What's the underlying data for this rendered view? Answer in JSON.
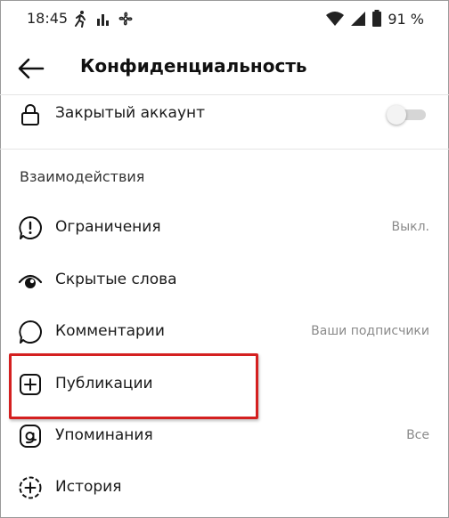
{
  "statusbar": {
    "time": "18:45",
    "battery": "91 %"
  },
  "header": {
    "title": "Конфиденциальность"
  },
  "private_account": {
    "label": "Закрытый аккаунт",
    "enabled": false
  },
  "interactions": {
    "section_title": "Взаимодействия",
    "items": [
      {
        "label": "Ограничения",
        "value": "Выкл."
      },
      {
        "label": "Скрытые слова",
        "value": ""
      },
      {
        "label": "Комментарии",
        "value": "Ваши подписчики"
      },
      {
        "label": "Публикации",
        "value": ""
      },
      {
        "label": "Упоминания",
        "value": "Все"
      },
      {
        "label": "История",
        "value": ""
      }
    ]
  },
  "colors": {
    "highlight_border": "#d42020",
    "toggle_off_track": "#d6d6d6"
  }
}
